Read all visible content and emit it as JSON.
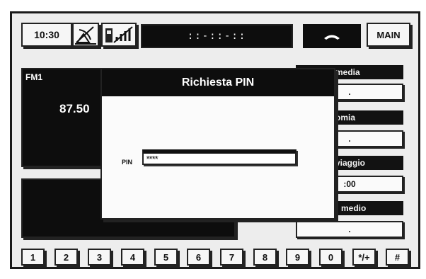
{
  "topbar": {
    "clock": "10:30",
    "display": "::-::-::",
    "main_label": "MAIN"
  },
  "radio": {
    "band": "FM1",
    "frequency": "87.50"
  },
  "trip": {
    "labels": [
      "media",
      "omia",
      "viaggio",
      "medio"
    ],
    "values": [
      ".",
      ".",
      ":00",
      "."
    ]
  },
  "dialog": {
    "title": "Richiesta PIN",
    "pin_label": "PIN",
    "pin_value": "****"
  },
  "keypad": {
    "keys": [
      "1",
      "2",
      "3",
      "4",
      "5",
      "6",
      "7",
      "8",
      "9",
      "0",
      "*/+",
      "#"
    ]
  }
}
